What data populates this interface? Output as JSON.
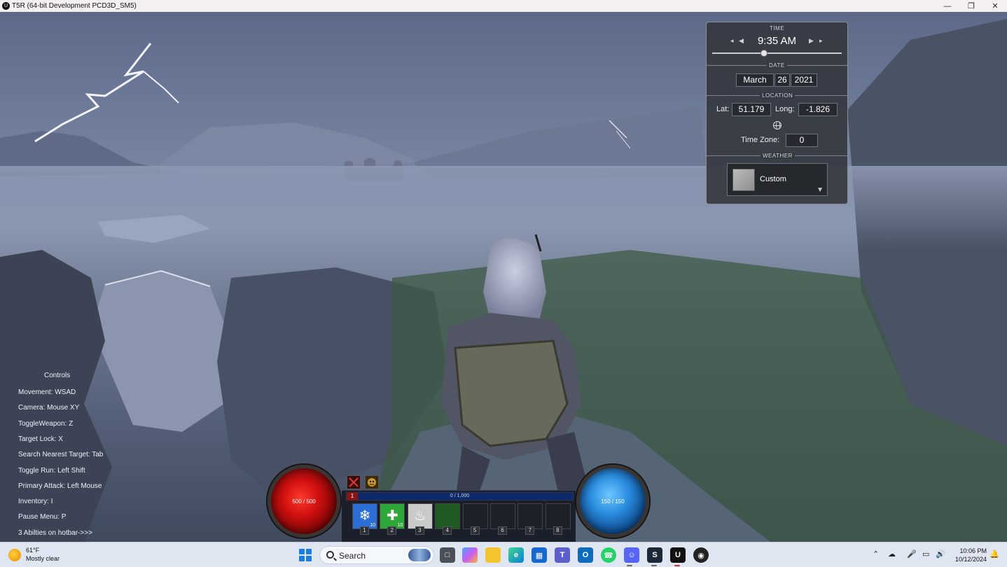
{
  "window": {
    "title": "T5R (64-bit Development PCD3D_SM5)",
    "buttons": [
      "minimize",
      "restore",
      "close"
    ]
  },
  "environment_panel": {
    "time": {
      "section": "TIME",
      "value": "9:35 AM",
      "day_fraction": 0.4
    },
    "date": {
      "section": "DATE",
      "month": "March",
      "day": "26",
      "year": "2021"
    },
    "location": {
      "section": "LOCATION",
      "lat_label": "Lat:",
      "lat": "51.179",
      "long_label": "Long:",
      "long": "-1.826",
      "timezone_label": "Time Zone:",
      "timezone": "0"
    },
    "weather": {
      "section": "WEATHER",
      "selected": "Custom"
    }
  },
  "controls": {
    "title": "Controls",
    "lines": [
      "Movement: WSAD",
      "Camera: Mouse XY",
      "ToggleWeapon: Z",
      "Target Lock: X",
      "Search Nearest Target: Tab",
      "Toggle Run: Left Shift",
      "Primary Attack: Left Mouse",
      "Inventory: I",
      "Pause Menu: P",
      "3 Abilties on hotbar->>>"
    ]
  },
  "hud": {
    "health": "500 / 500",
    "mana": "150 / 150",
    "level": "1",
    "xp": "0 / 1,000",
    "xp_fraction": 0,
    "slots": [
      {
        "num": "1",
        "icon": "ice-shard-icon",
        "count": "10",
        "color": "#2b6fd6"
      },
      {
        "num": "2",
        "icon": "heal-cross-icon",
        "count": "10",
        "color": "#2fa83a"
      },
      {
        "num": "3",
        "icon": "flame-icon",
        "count": "",
        "color": "#c9c9c9"
      },
      {
        "num": "4",
        "icon": "",
        "count": "",
        "color": "#1f5a22"
      },
      {
        "num": "5",
        "icon": "",
        "count": "",
        "color": ""
      },
      {
        "num": "6",
        "icon": "",
        "count": "",
        "color": ""
      },
      {
        "num": "7",
        "icon": "",
        "count": "",
        "color": ""
      },
      {
        "num": "8",
        "icon": "",
        "count": "",
        "color": ""
      }
    ],
    "status_icons": [
      "crossed-swords-icon",
      "demon-face-icon"
    ]
  },
  "taskbar": {
    "weather_temp": "61°F",
    "weather_cond": "Mostly clear",
    "search_label": "Search",
    "time": "10:06 PM",
    "date": "10/12/2024",
    "apps": [
      "task-view-icon",
      "copilot-icon",
      "file-explorer-icon",
      "edge-icon",
      "store-icon",
      "teams-icon",
      "outlook-icon",
      "whatsapp-icon",
      "discord-icon",
      "steam-icon",
      "unreal-engine-icon",
      "github-icon"
    ]
  }
}
